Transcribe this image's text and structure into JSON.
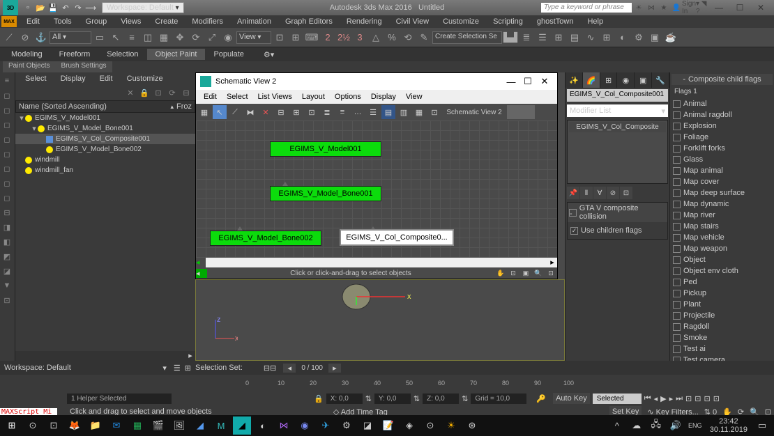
{
  "title": {
    "workspace": "Workspace: Default",
    "app": "Autodesk 3ds Max 2016",
    "doc": "Untitled",
    "search": "Type a keyword or phrase",
    "signin": "Sign In"
  },
  "menu": {
    "items": [
      "Edit",
      "Tools",
      "Group",
      "Views",
      "Create",
      "Modifiers",
      "Animation",
      "Graph Editors",
      "Rendering",
      "Civil View",
      "Customize",
      "Scripting",
      "ghostTown",
      "Help"
    ]
  },
  "ribbon": {
    "tabs": [
      "Modeling",
      "Freeform",
      "Selection",
      "Object Paint",
      "Populate"
    ],
    "sub": [
      "Paint Objects",
      "Brush Settings"
    ]
  },
  "toolbar": {
    "selAll": "All",
    "view": "View",
    "createSel": "Create Selection Se"
  },
  "scene": {
    "menus": [
      "Select",
      "Display",
      "Edit",
      "Customize"
    ],
    "header": "Name (Sorted Ascending)",
    "headerR": "Froz",
    "tree": [
      {
        "d": 0,
        "t": "▾",
        "i": "bulb",
        "n": "EGIMS_V_Model001"
      },
      {
        "d": 1,
        "t": "▾",
        "i": "bulb",
        "n": "EGIMS_V_Model_Bone001"
      },
      {
        "d": 2,
        "t": "",
        "i": "cube",
        "n": "EGIMS_V_Col_Composite001",
        "sel": true
      },
      {
        "d": 2,
        "t": "",
        "i": "bulb",
        "n": "EGIMS_V_Model_Bone002"
      },
      {
        "d": 0,
        "t": "",
        "i": "bulb",
        "n": "windmill"
      },
      {
        "d": 0,
        "t": "",
        "i": "bulb",
        "n": "windmill_fan"
      }
    ]
  },
  "schematic": {
    "title": "Schematic View 2",
    "menus": [
      "Edit",
      "Select",
      "List Views",
      "Layout",
      "Options",
      "Display",
      "View"
    ],
    "bm": "Schematic View 2",
    "hint": "Click or click-and-drag to select objects",
    "nodes": {
      "a": "EGIMS_V_Model001",
      "b": "EGIMS_V_Model_Bone001",
      "c": "EGIMS_V_Model_Bone002",
      "d": "EGIMS_V_Col_Composite0..."
    }
  },
  "cmd": {
    "obj": "EGIMS_V_Col_Composite001",
    "ml": "Modifier List",
    "stack": "EGIMS_V_Col_Composite",
    "roll": "GTA V composite collision",
    "chk": "Use children flags"
  },
  "flags": {
    "title": "Composite child flags",
    "header": "Flags 1",
    "items": [
      "Animal",
      "Animal ragdoll",
      "Explosion",
      "Foliage",
      "Forklift forks",
      "Glass",
      "Map animal",
      "Map cover",
      "Map deep surface",
      "Map dynamic",
      "Map river",
      "Map stairs",
      "Map vehicle",
      "Map weapon",
      "Object",
      "Object env cloth",
      "Ped",
      "Pickup",
      "Plant",
      "Projectile",
      "Ragdoll",
      "Smoke",
      "Test ai",
      "Test camera"
    ]
  },
  "bottom": {
    "ws": "Workspace: Default",
    "selset": "Selection Set:",
    "frame": "0 / 100",
    "helper": "1 Helper Selected",
    "hint": "Click and drag to select and move objects",
    "x": "X: 0,0",
    "y": "Y: 0,0",
    "z": "Z: 0,0",
    "grid": "Grid = 10,0",
    "autokey": "Auto Key",
    "selected": "Selected",
    "setkey": "Set Key",
    "keyfilt": "Key Filters...",
    "addtag": "Add Time Tag"
  },
  "tray": {
    "time": "23:42",
    "date": "30.11.2019"
  }
}
